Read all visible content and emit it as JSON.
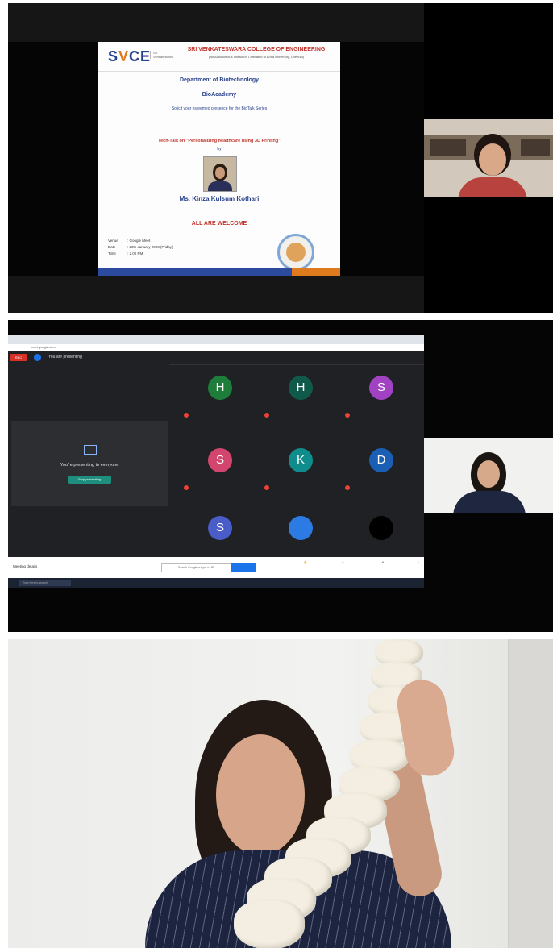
{
  "panel1": {
    "poster": {
      "logo": "SVCE",
      "college": "SRI VENKATESWARA COLLEGE OF ENGINEERING",
      "college_sub": "(An Autonomous Institution • Affiliated to Anna University, Chennai)",
      "department": "Department of Biotechnology",
      "bioacademy": "BioAcademy",
      "invite": "Solicit your esteemed presence for the BioTalk Series",
      "talk": "Tech-Talk on \"Personalizing healthcare using 3D Printing\"",
      "by": "by",
      "speaker": "Ms. Kinza Kulsum Kothari",
      "welcome": "ALL ARE WELCOME",
      "venue_label": "Venue",
      "venue": ": Google Meet",
      "date_label": "Date",
      "date": ": 20th January 2023 (Friday)",
      "time_label": "Time",
      "time": ": 2.00 PM"
    }
  },
  "panel2": {
    "presenting_label": "You are presenting",
    "presenting_message": "You're presenting to everyone",
    "stop_button": "Stop presenting",
    "participants": [
      {
        "initial": "H",
        "color": "#1e7d3a"
      },
      {
        "initial": "H",
        "color": "#0f5a4a"
      },
      {
        "initial": "S",
        "color": "#a142c2"
      },
      {
        "initial": "S",
        "color": "#d1456e"
      },
      {
        "initial": "K",
        "color": "#0f8c8c"
      },
      {
        "initial": "D",
        "color": "#1a5fb4"
      },
      {
        "initial": "S",
        "color": "#4a5cc7"
      },
      {
        "initial": "",
        "color": "#2c7be5"
      },
      {
        "initial": "",
        "color": "#000000"
      }
    ],
    "meeting_details": "Meeting details",
    "search_placeholder": "Search Google or type a URL",
    "taskbar_search": "Type here to search"
  }
}
